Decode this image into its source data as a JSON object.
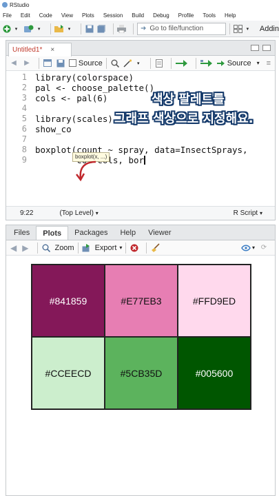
{
  "app": {
    "title": "RStudio"
  },
  "menu": [
    "File",
    "Edit",
    "Code",
    "View",
    "Plots",
    "Session",
    "Build",
    "Debug",
    "Profile",
    "Tools",
    "Help"
  ],
  "toolbar": {
    "goto_placeholder": "Go to file/function",
    "addins_label": "Addin"
  },
  "editor": {
    "tab_label": "Untitled1*",
    "source_on_save_label": "Source",
    "source_button_label": "Source",
    "lines": [
      {
        "n": "1",
        "text": "library(colorspace)"
      },
      {
        "n": "2",
        "text": "pal <- choose_palette()"
      },
      {
        "n": "3",
        "text": "cols <- pal(6)"
      },
      {
        "n": "4",
        "text": ""
      },
      {
        "n": "5",
        "text": "library(scales)"
      },
      {
        "n": "6",
        "text": "show_co"
      },
      {
        "n": "7",
        "text": ""
      },
      {
        "n": "8",
        "text": "boxplot(count ~ spray, data=InsectSprays,"
      },
      {
        "n": "9",
        "text": "        col=cols, bor"
      }
    ],
    "tooltip": "boxplot(x, ...)",
    "status": {
      "position": "9:22",
      "scope": "(Top Level)",
      "filetype": "R Script"
    }
  },
  "captions": {
    "line1": "색상 팔레트를",
    "line2": "그래프 색상으로 지정해요."
  },
  "viewer": {
    "tabs": [
      "Files",
      "Plots",
      "Packages",
      "Help",
      "Viewer"
    ],
    "active_tab": "Plots",
    "zoom_label": "Zoom",
    "export_label": "Export"
  },
  "palette": [
    {
      "hex": "#841859",
      "text_color": "#ffffff"
    },
    {
      "hex": "#E77EB3",
      "text_color": "#111111"
    },
    {
      "hex": "#FFD9ED",
      "text_color": "#111111"
    },
    {
      "hex": "#CCEECD",
      "text_color": "#111111"
    },
    {
      "hex": "#5CB35D",
      "text_color": "#111111"
    },
    {
      "hex": "#005600",
      "text_color": "#ffffff"
    }
  ]
}
